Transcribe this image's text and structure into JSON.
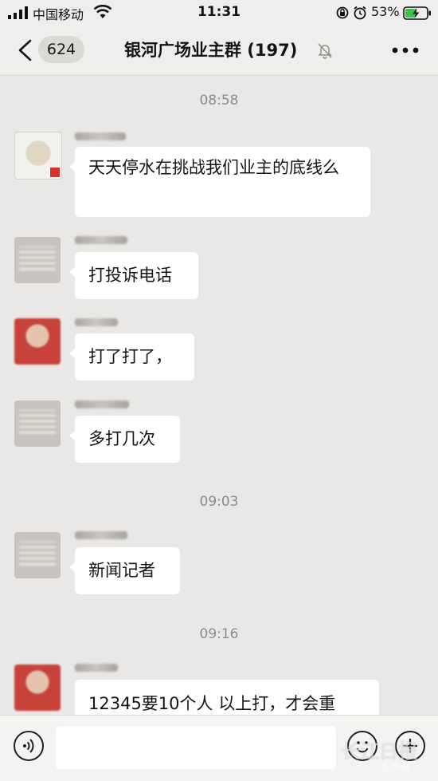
{
  "status_bar": {
    "carrier": "中国移动",
    "time": "11:31",
    "battery_percent": "53%",
    "battery_level": 0.53
  },
  "nav": {
    "unread_count": "624",
    "title": "银河广场业主群 (197)"
  },
  "messages": [
    {
      "time_separator": "08:58",
      "text": "天天停水在挑战我们业主的底线么"
    },
    {
      "text": "打投诉电话"
    },
    {
      "text": "打了打了，"
    },
    {
      "text": "多打几次"
    },
    {
      "time_separator": "09:03",
      "text": "新闻记者"
    },
    {
      "time_separator": "09:16",
      "text": "12345要10个人 以上打，才会重"
    }
  ],
  "input": {
    "placeholder": ""
  },
  "watermark": {
    "logo_text": "长江日报",
    "sub_text": "客户端"
  }
}
